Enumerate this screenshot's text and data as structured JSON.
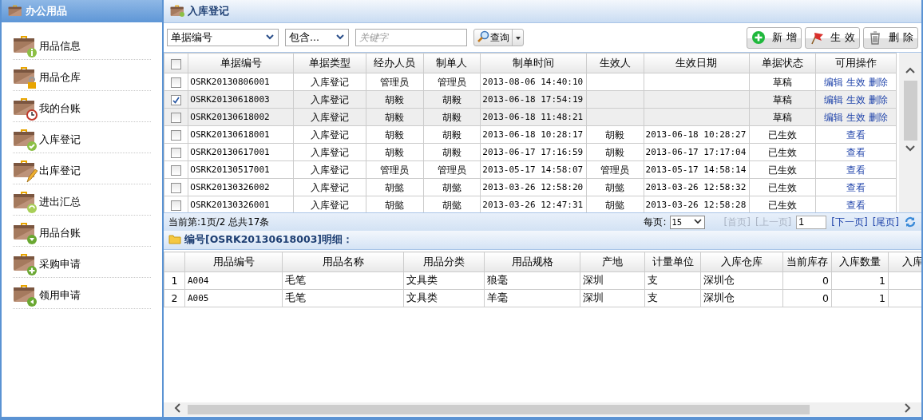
{
  "sidebar": {
    "title": "办公用品",
    "items": [
      {
        "label": "用品信息"
      },
      {
        "label": "用品仓库"
      },
      {
        "label": "我的台账"
      },
      {
        "label": "入库登记"
      },
      {
        "label": "出库登记"
      },
      {
        "label": "进出汇总"
      },
      {
        "label": "用品台账"
      },
      {
        "label": "采购申请"
      },
      {
        "label": "领用申请"
      }
    ]
  },
  "panel": {
    "title": "入库登记"
  },
  "filter": {
    "field": "单据编号",
    "operator": "包含...",
    "keyword_placeholder": "关键字",
    "search_button": "查询"
  },
  "toolbar_buttons": [
    "新 增",
    "生 效",
    "删 除"
  ],
  "table": {
    "header_checked": false,
    "columns": [
      "单据编号",
      "单据类型",
      "经办人员",
      "制单人",
      "制单时间",
      "生效人",
      "生效日期",
      "单据状态",
      "可用操作"
    ],
    "rows": [
      {
        "checked": false,
        "highlighted": false,
        "cells": [
          "OSRK20130806001",
          "入库登记",
          "管理员",
          "管理员",
          "2013-08-06 14:40:10",
          "",
          "",
          "草稿"
        ],
        "actions": [
          "编辑",
          "生效",
          "删除"
        ]
      },
      {
        "checked": true,
        "highlighted": true,
        "cells": [
          "OSRK20130618003",
          "入库登记",
          "胡毅",
          "胡毅",
          "2013-06-18 17:54:19",
          "",
          "",
          "草稿"
        ],
        "actions": [
          "编辑",
          "生效",
          "删除"
        ]
      },
      {
        "checked": false,
        "highlighted": true,
        "cells": [
          "OSRK20130618002",
          "入库登记",
          "胡毅",
          "胡毅",
          "2013-06-18 11:48:21",
          "",
          "",
          "草稿"
        ],
        "actions": [
          "编辑",
          "生效",
          "删除"
        ]
      },
      {
        "checked": false,
        "highlighted": false,
        "cells": [
          "OSRK20130618001",
          "入库登记",
          "胡毅",
          "胡毅",
          "2013-06-18 10:28:17",
          "胡毅",
          "2013-06-18 10:28:27",
          "已生效"
        ],
        "actions": [
          "查看"
        ]
      },
      {
        "checked": false,
        "highlighted": false,
        "cells": [
          "OSRK20130617001",
          "入库登记",
          "胡毅",
          "胡毅",
          "2013-06-17 17:16:59",
          "胡毅",
          "2013-06-17 17:17:04",
          "已生效"
        ],
        "actions": [
          "查看"
        ]
      },
      {
        "checked": false,
        "highlighted": false,
        "cells": [
          "OSRK20130517001",
          "入库登记",
          "管理员",
          "管理员",
          "2013-05-17 14:58:07",
          "管理员",
          "2013-05-17 14:58:14",
          "已生效"
        ],
        "actions": [
          "查看"
        ]
      },
      {
        "checked": false,
        "highlighted": false,
        "cells": [
          "OSRK20130326002",
          "入库登记",
          "胡懿",
          "胡懿",
          "2013-03-26 12:58:20",
          "胡懿",
          "2013-03-26 12:58:32",
          "已生效"
        ],
        "actions": [
          "查看"
        ]
      },
      {
        "checked": false,
        "highlighted": false,
        "cells": [
          "OSRK20130326001",
          "入库登记",
          "胡懿",
          "胡懿",
          "2013-03-26 12:47:31",
          "胡懿",
          "2013-03-26 12:58:28",
          "已生效"
        ],
        "actions": [
          "查看"
        ]
      }
    ]
  },
  "pager": {
    "summary": "当前第:1页/2 总共17条",
    "page_size_label": "每页:",
    "page_size": "15",
    "links": [
      {
        "label": "[首页]",
        "disabled": true
      },
      {
        "label": "[上一页]",
        "disabled": true
      },
      {
        "label": "[下一页]",
        "disabled": false
      },
      {
        "label": "[尾页]",
        "disabled": false
      }
    ],
    "page": "1"
  },
  "detail": {
    "title": "编号[OSRK20130618003]明细：",
    "columns": [
      "用品编号",
      "用品名称",
      "用品分类",
      "用品规格",
      "产地",
      "计量单位",
      "入库仓库",
      "当前库存",
      "入库数量",
      "入库"
    ],
    "rows": [
      {
        "number": "1",
        "cells": [
          "A004",
          "毛笔",
          "文具类",
          "狼毫",
          "深圳",
          "支",
          "深圳仓",
          "0",
          "1"
        ]
      },
      {
        "number": "2",
        "cells": [
          "A005",
          "毛笔",
          "文具类",
          "羊毫",
          "深圳",
          "支",
          "深圳仓",
          "0",
          "1"
        ]
      }
    ]
  }
}
